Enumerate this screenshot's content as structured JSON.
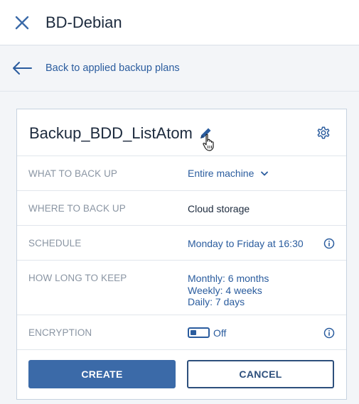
{
  "window": {
    "title": "BD-Debian"
  },
  "nav": {
    "back_label": "Back to applied backup plans"
  },
  "plan": {
    "name": "Backup_BDD_ListAtom"
  },
  "settings": {
    "what_label": "WHAT TO BACK UP",
    "what_value": "Entire machine",
    "where_label": "WHERE TO BACK UP",
    "where_value": "Cloud storage",
    "schedule_label": "SCHEDULE",
    "schedule_value": "Monday to Friday at 16:30",
    "retention_label": "HOW LONG TO KEEP",
    "retention_values": [
      "Monthly: 6 months",
      "Weekly: 4 weeks",
      "Daily: 7 days"
    ],
    "encryption_label": "ENCRYPTION",
    "encryption_value": "Off"
  },
  "actions": {
    "create_label": "CREATE",
    "cancel_label": "CANCEL"
  },
  "colors": {
    "accent": "#2a5c9e",
    "button_primary": "#3b6aa8",
    "label_gray": "#8a95a3",
    "border": "#c7d3e0"
  },
  "icons": [
    "close-icon",
    "back-arrow-icon",
    "edit-pencil-icon",
    "hand-cursor-icon",
    "gear-icon",
    "chevron-down-icon",
    "info-icon"
  ]
}
